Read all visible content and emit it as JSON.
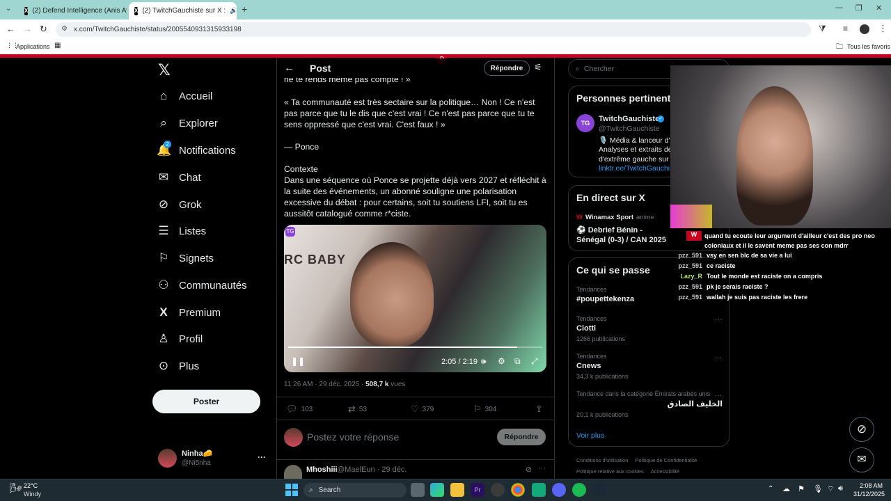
{
  "browser": {
    "tabs": [
      {
        "title": "(2) Defend Intelligence (Anis Ay",
        "active": false
      },
      {
        "title": "(2) TwitchGauchiste sur X :",
        "active": true
      }
    ],
    "url": "x.com/TwitchGauchiste/status/2005540931315933198",
    "bookmarks": {
      "apps": "Applications",
      "all": "Tous les favoris"
    }
  },
  "nav": {
    "items": [
      {
        "label": "Accueil",
        "icon": "home-icon"
      },
      {
        "label": "Explorer",
        "icon": "search-icon"
      },
      {
        "label": "Notifications",
        "icon": "bell-icon",
        "badge": "2"
      },
      {
        "label": "Chat",
        "icon": "mail-icon"
      },
      {
        "label": "Grok",
        "icon": "grok-icon"
      },
      {
        "label": "Listes",
        "icon": "list-icon"
      },
      {
        "label": "Signets",
        "icon": "bookmark-icon"
      },
      {
        "label": "Communautés",
        "icon": "community-icon"
      },
      {
        "label": "Premium",
        "icon": "x-icon"
      },
      {
        "label": "Profil",
        "icon": "profile-icon"
      },
      {
        "label": "Plus",
        "icon": "more-icon"
      }
    ],
    "post_button": "Poster",
    "account": {
      "name": "Ninha🧀",
      "handle": "@Ni5nha"
    }
  },
  "post": {
    "header_title": "Post",
    "reply_button": "Répondre",
    "truncated_line": "ne te rends même pas compte ! »",
    "quote": "« Ta communauté est très sectaire sur la politique… Non ! Ce n'est pas parce que tu le dis que c'est vrai ! Ce n'est pas parce que tu te sens oppressé que c'est vrai. C'est faux ! »",
    "author_line": "— Ponce",
    "context_title": "Contexte",
    "context": "Dans une séquence où Ponce se projette déjà vers 2027 et réfléchit à la suite des événements, un abonné souligne une polarisation excessive du débat : pour certains, soit tu soutiens LFI, soit tu es aussitôt catalogué comme r*ciste.",
    "video": {
      "time": "2:05 / 2:19",
      "progress": 0.9,
      "overlay_text": "RC BABY"
    },
    "timestamp": "11:26 AM · 29 déc. 2025 · ",
    "views_count": "508,7 k",
    "views_label": " vues",
    "stats": {
      "replies": "103",
      "reposts": "53",
      "likes": "379",
      "bookmarks": "304"
    },
    "reply_placeholder": "Postez votre réponse",
    "reply_submit": "Répondre",
    "next_reply": {
      "name": "Mhoshiii",
      "meta": "@MaelEun · 29 déc."
    }
  },
  "sidebar": {
    "search_placeholder": "Chercher",
    "relevant": {
      "title": "Personnes pertinent",
      "name": "TwitchGauchiste",
      "handle": "@TwitchGauchiste",
      "bio1": "🎙️ Média & lanceur d'a",
      "bio2": "Analyses et extraits de",
      "bio3": "d'extrême gauche sur T",
      "link": "linktr.ee/TwitchGauchi"
    },
    "live": {
      "title": "En direct sur X",
      "host": "Winamax Sport",
      "host_extra": "anime",
      "event": "⚽ Debrief Bénin - Sénégal (0-3) / CAN 2025"
    },
    "trends": {
      "title": "Ce qui se passe",
      "items": [
        {
          "category": "Tendances",
          "name": "#poupettekenza",
          "count": ""
        },
        {
          "category": "Tendances",
          "name": "Ciotti",
          "count": "1266 publications"
        },
        {
          "category": "Tendances",
          "name": "Cnews",
          "count": "34,3 k publications"
        },
        {
          "category": "Tendance dans la catégorie Émirats arabes unis",
          "name": "الخليف الصادق",
          "count": "20,1 k publications"
        }
      ],
      "see_more": "Voir plus"
    },
    "footer": [
      "Conditions d'utilisation",
      "Politique de Confidentialité",
      "Politique relative aux cookies",
      "Accessibilité"
    ]
  },
  "stream_chat": [
    {
      "user": "",
      "text": "quand tu ecoute leur argument d'ailleur c'est des pro neo coloniaux et il le savent meme pas ses con mdrr"
    },
    {
      "user": "pzz_591",
      "text": "vsy en sen blc de sa vie a lui"
    },
    {
      "user": "pzz_591",
      "text": "ce raciste"
    },
    {
      "user": "Lazy_R",
      "text": "Tout le monde est raciste on a compris"
    },
    {
      "user": "pzz_591",
      "text": "pk je serais raciste ?"
    },
    {
      "user": "pzz_591",
      "text": "wallah je suis pas raciste les frere"
    }
  ],
  "taskbar": {
    "weather_temp": "22°C",
    "weather_desc": "Windy",
    "search": "Search",
    "time": "2:08 AM",
    "date": "31/12/2025"
  },
  "colors": {
    "accent": "#1d9bf0",
    "brand_red": "#c4041f",
    "background": "#000000"
  }
}
